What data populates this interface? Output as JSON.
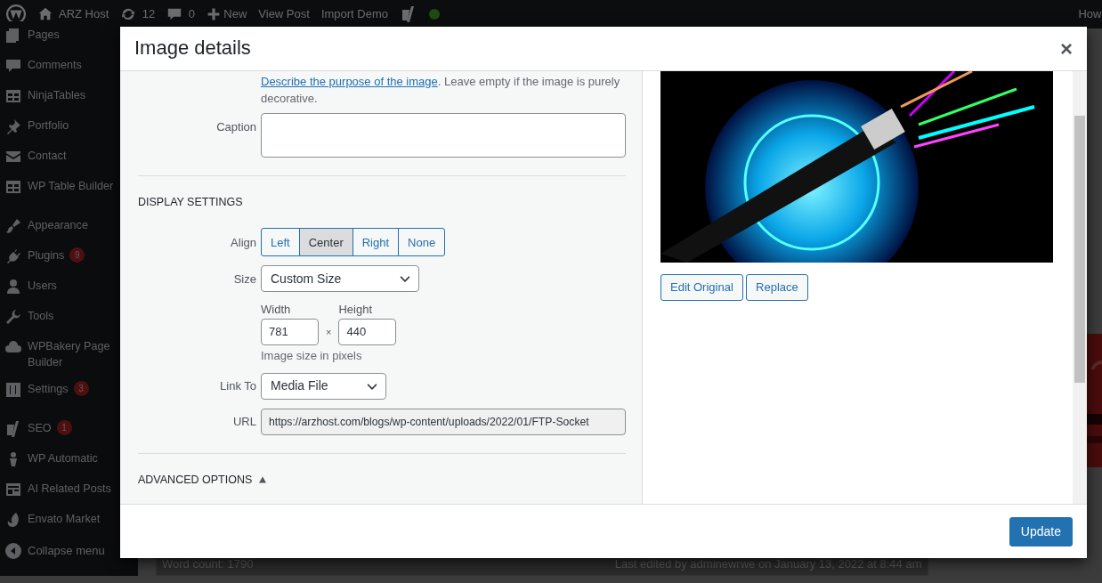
{
  "admin_bar": {
    "site_name": "ARZ Host",
    "updates": "12",
    "comments": "0",
    "new": "New",
    "links": [
      "View Post",
      "Import Demo"
    ],
    "account": "How"
  },
  "sidebar": {
    "groups": [
      [
        {
          "label": "Pages"
        },
        {
          "label": "Comments"
        },
        {
          "label": "NinjaTables"
        },
        {
          "label": "Portfolio"
        },
        {
          "label": "Contact"
        },
        {
          "label": "WP Table Builder"
        }
      ],
      [
        {
          "label": "Appearance"
        },
        {
          "label": "Plugins",
          "badge": "9"
        },
        {
          "label": "Users"
        },
        {
          "label": "Tools"
        },
        {
          "label": "WPBakery Page Builder"
        },
        {
          "label": "Settings",
          "badge": "3"
        }
      ],
      [
        {
          "label": "SEO",
          "badge": "1"
        },
        {
          "label": "WP Automatic"
        },
        {
          "label": "AI Related Posts"
        },
        {
          "label": "Envato Market"
        }
      ]
    ],
    "collapse": "Collapse menu"
  },
  "editor_footer": {
    "word_count": "Word count: 1790",
    "last_edited": "Last edited by adminewrwe on January 13, 2022 at 8:44 am"
  },
  "modal": {
    "title": "Image details",
    "close": "×",
    "alt_help": {
      "link": "Describe the purpose of the image",
      "text": ". Leave empty if the image is purely decorative."
    },
    "caption": {
      "label": "Caption"
    },
    "display_settings": {
      "heading": "DISPLAY SETTINGS",
      "align": {
        "label": "Align",
        "options": [
          {
            "label": "Left",
            "selected": false
          },
          {
            "label": "Center",
            "selected": true
          },
          {
            "label": "Right",
            "selected": false
          },
          {
            "label": "None",
            "selected": false
          }
        ]
      },
      "size": {
        "label": "Size",
        "value": "Custom Size"
      },
      "width": {
        "label": "Width",
        "value": "781"
      },
      "times": "×",
      "height": {
        "label": "Height",
        "value": "440"
      },
      "size_hint": "Image size in pixels",
      "link_to": {
        "label": "Link To",
        "value": "Media File"
      },
      "url": {
        "label": "URL",
        "value": "https://arzhost.com/blogs/wp-content/uploads/2022/01/FTP-Socket"
      }
    },
    "advanced": {
      "label": "ADVANCED OPTIONS"
    },
    "preview": {
      "kind": "picture"
    },
    "image_buttons": [
      "Edit Original",
      "Replace"
    ],
    "primary_button": "Update"
  }
}
